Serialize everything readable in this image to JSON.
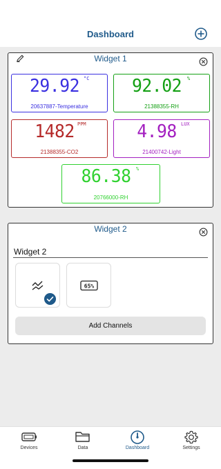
{
  "header": {
    "title": "Dashboard",
    "add_icon": "plus-circle-icon"
  },
  "colors": {
    "accent": "#1f5a8a",
    "background": "#ececec"
  },
  "widget1": {
    "title": "Widget 1",
    "tiles": [
      {
        "value": "29.92",
        "unit": "°C",
        "label": "20637887-Temperature",
        "color": "#3a2fe0"
      },
      {
        "value": "92.02",
        "unit": "%",
        "label": "21388355-RH",
        "color": "#14a014"
      },
      {
        "value": "1482",
        "unit": "PPM",
        "label": "21388355-CO2",
        "color": "#b52a2a"
      },
      {
        "value": "4.98",
        "unit": "LUX",
        "label": "21400742-Light",
        "color": "#a31fc0"
      },
      {
        "value": "86.38",
        "unit": "%",
        "label": "20766000-RH",
        "color": "#2fd12f"
      }
    ]
  },
  "widget2": {
    "title": "Widget 2",
    "name_value": "Widget 2",
    "chips": [
      {
        "icon": "line-chart-icon",
        "selected": true
      },
      {
        "icon": "percent-display-icon",
        "selected": false
      }
    ],
    "add_channels_label": "Add Channels"
  },
  "tabs": [
    {
      "label": "Devices",
      "icon": "battery-icon"
    },
    {
      "label": "Data",
      "icon": "folder-icon"
    },
    {
      "label": "Dashboard",
      "icon": "gauge-icon",
      "active": true
    },
    {
      "label": "Settings",
      "icon": "gear-icon"
    }
  ]
}
